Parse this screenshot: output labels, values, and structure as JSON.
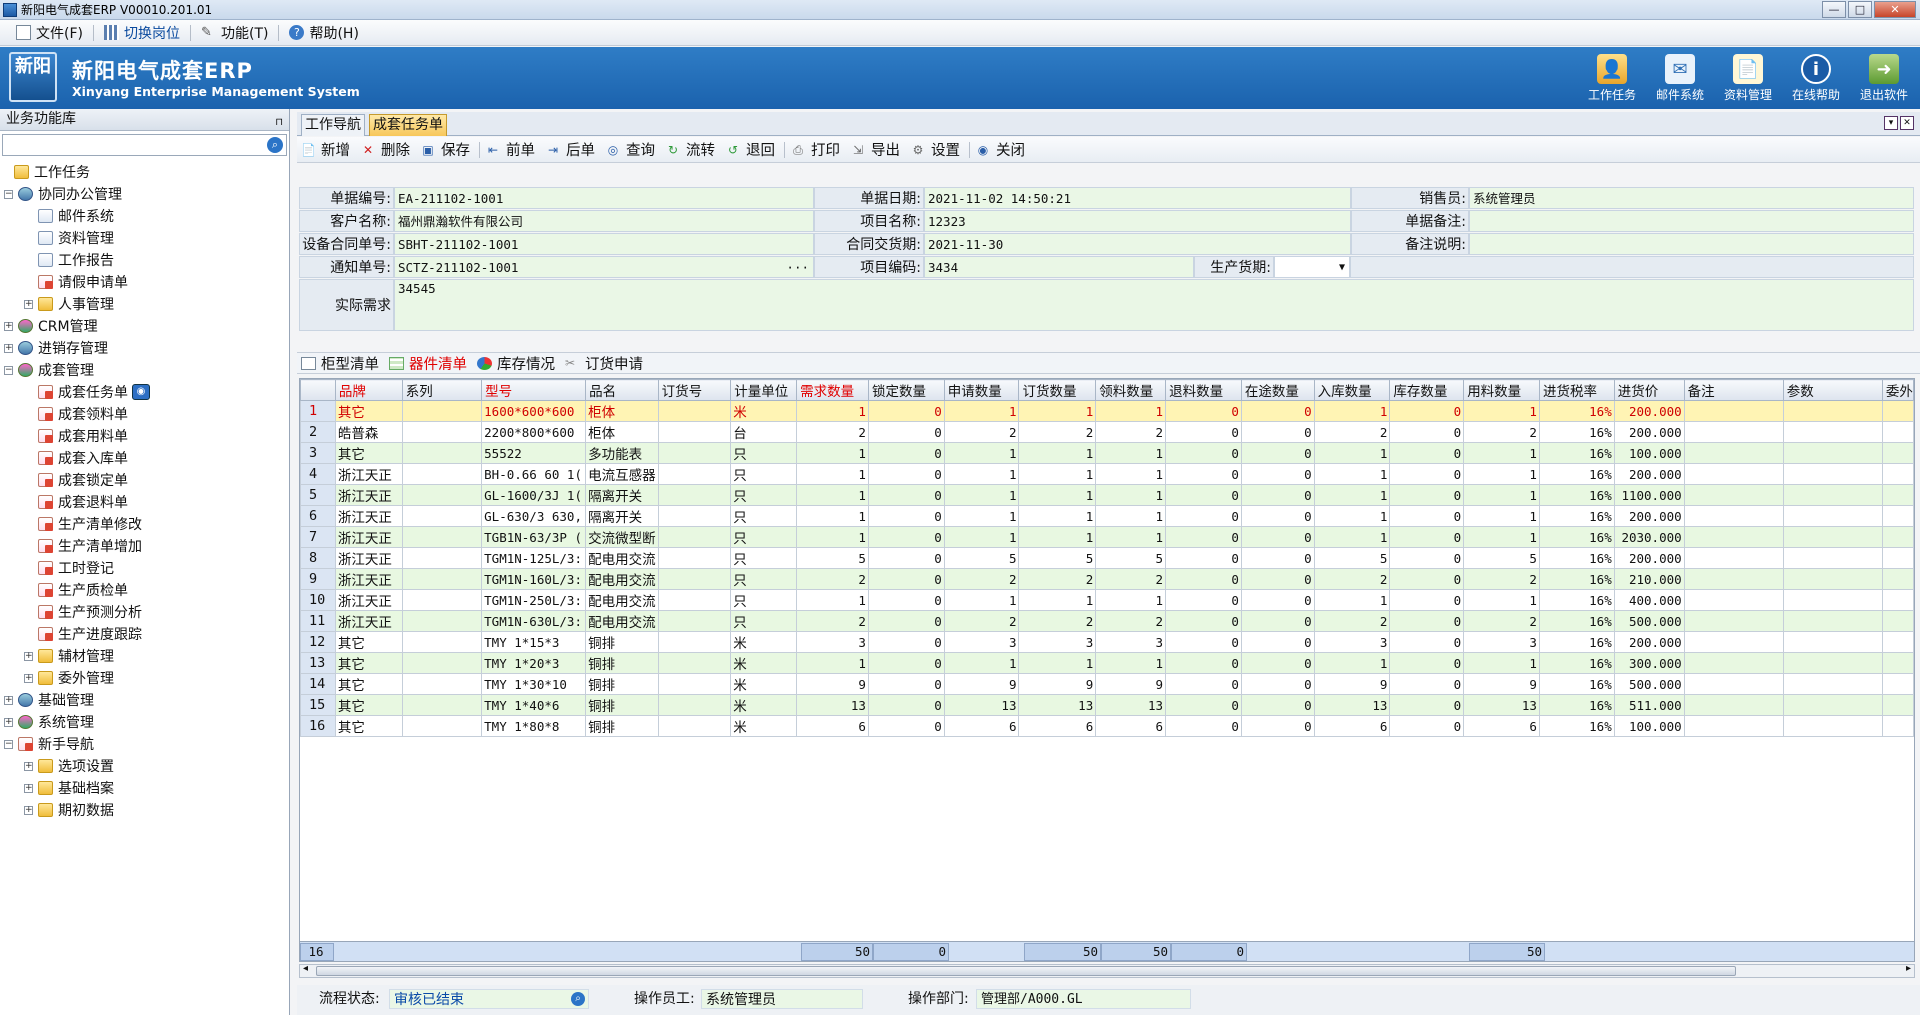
{
  "window": {
    "title": "新阳电气成套ERP V00010.201.01"
  },
  "menu": [
    {
      "label": "文件(F)"
    },
    {
      "label": "切换岗位"
    },
    {
      "label": "功能(T)"
    },
    {
      "label": "帮助(H)"
    }
  ],
  "header": {
    "logo": "新阳",
    "title": "新阳电气成套ERP",
    "subtitle": "Xinyang Enterprise Management System",
    "tools": [
      "工作任务",
      "邮件系统",
      "资料管理",
      "在线帮助",
      "退出软件"
    ]
  },
  "sidebar": {
    "title": "业务功能库",
    "items": [
      {
        "label": "工作任务"
      },
      {
        "label": "协同办公管理"
      },
      {
        "label": "邮件系统"
      },
      {
        "label": "资料管理"
      },
      {
        "label": "工作报告"
      },
      {
        "label": "请假申请单"
      },
      {
        "label": "人事管理"
      },
      {
        "label": "CRM管理"
      },
      {
        "label": "进销存管理"
      },
      {
        "label": "成套管理"
      },
      {
        "label": "成套任务单"
      },
      {
        "label": "成套领料单"
      },
      {
        "label": "成套用料单"
      },
      {
        "label": "成套入库单"
      },
      {
        "label": "成套锁定单"
      },
      {
        "label": "成套退料单"
      },
      {
        "label": "生产清单修改"
      },
      {
        "label": "生产清单增加"
      },
      {
        "label": "工时登记"
      },
      {
        "label": "生产质检单"
      },
      {
        "label": "生产预测分析"
      },
      {
        "label": "生产进度跟踪"
      },
      {
        "label": "辅材管理"
      },
      {
        "label": "委外管理"
      },
      {
        "label": "基础管理"
      },
      {
        "label": "系统管理"
      },
      {
        "label": "新手导航"
      },
      {
        "label": "选项设置"
      },
      {
        "label": "基础档案"
      },
      {
        "label": "期初数据"
      }
    ]
  },
  "tabs": [
    "工作导航",
    "成套任务单"
  ],
  "toolbar": [
    "新增",
    "删除",
    "保存",
    "前单",
    "后单",
    "查询",
    "流转",
    "退回",
    "打印",
    "导出",
    "设置",
    "关闭"
  ],
  "form": {
    "doc_no_label": "单据编号:",
    "doc_no": "EA-211102-1001",
    "doc_date_label": "单据日期:",
    "doc_date": "2021-11-02 14:50:21",
    "sales_label": "销售员:",
    "sales": "系统管理员",
    "customer_label": "客户名称:",
    "customer": "福州鼎瀚软件有限公司",
    "project_label": "项目名称:",
    "project": "12323",
    "remark_label": "单据备注:",
    "remark": "",
    "contract_label": "设备合同单号:",
    "contract": "SBHT-211102-1001",
    "delivery_label": "合同交货期:",
    "delivery": "2021-11-30",
    "note_label": "备注说明:",
    "note": "",
    "notice_label": "通知单号:",
    "notice": "SCTZ-211102-1001",
    "notice_btn": "···",
    "code_label": "项目编码:",
    "code": "3434",
    "prod_label": "生产货期:",
    "prod": "",
    "demand_label": "实际需求",
    "demand": "34545"
  },
  "subtabs": [
    "柜型清单",
    "器件清单",
    "库存情况",
    "订货申请"
  ],
  "grid": {
    "columns": [
      "",
      "品牌",
      "系列",
      "型号",
      "品名",
      "订货号",
      "计量单位",
      "需求数量",
      "锁定数量",
      "申请数量",
      "订货数量",
      "领料数量",
      "退料数量",
      "在途数量",
      "入库数量",
      "库存数量",
      "用料数量",
      "进货税率",
      "进货价",
      "备注",
      "参数",
      "委外"
    ],
    "rows": [
      [
        "1",
        "其它",
        "",
        "1600*600*600",
        "柜体",
        "",
        "米",
        "1",
        "0",
        "1",
        "1",
        "1",
        "0",
        "0",
        "1",
        "0",
        "1",
        "16%",
        "200.000",
        "",
        "",
        ""
      ],
      [
        "2",
        "皓普森",
        "",
        "2200*800*600",
        "柜体",
        "",
        "台",
        "2",
        "0",
        "2",
        "2",
        "2",
        "0",
        "0",
        "2",
        "0",
        "2",
        "16%",
        "200.000",
        "",
        "",
        ""
      ],
      [
        "3",
        "其它",
        "",
        "55522",
        "多功能表",
        "",
        "只",
        "1",
        "0",
        "1",
        "1",
        "1",
        "0",
        "0",
        "1",
        "0",
        "1",
        "16%",
        "100.000",
        "",
        "",
        ""
      ],
      [
        "4",
        "浙江天正",
        "",
        "BH-0.66 60 1(",
        "电流互感器",
        "",
        "只",
        "1",
        "0",
        "1",
        "1",
        "1",
        "0",
        "0",
        "1",
        "0",
        "1",
        "16%",
        "200.000",
        "",
        "",
        ""
      ],
      [
        "5",
        "浙江天正",
        "",
        "GL-1600/3J 1(",
        "隔离开关",
        "",
        "只",
        "1",
        "0",
        "1",
        "1",
        "1",
        "0",
        "0",
        "1",
        "0",
        "1",
        "16%",
        "1100.000",
        "",
        "",
        ""
      ],
      [
        "6",
        "浙江天正",
        "",
        "GL-630/3 630,",
        "隔离开关",
        "",
        "只",
        "1",
        "0",
        "1",
        "1",
        "1",
        "0",
        "0",
        "1",
        "0",
        "1",
        "16%",
        "200.000",
        "",
        "",
        ""
      ],
      [
        "7",
        "浙江天正",
        "",
        "TGB1N-63/3P (",
        "交流微型断",
        "",
        "只",
        "1",
        "0",
        "1",
        "1",
        "1",
        "0",
        "0",
        "1",
        "0",
        "1",
        "16%",
        "2030.000",
        "",
        "",
        ""
      ],
      [
        "8",
        "浙江天正",
        "",
        "TGM1N-125L/3:",
        "配电用交流",
        "",
        "只",
        "5",
        "0",
        "5",
        "5",
        "5",
        "0",
        "0",
        "5",
        "0",
        "5",
        "16%",
        "200.000",
        "",
        "",
        ""
      ],
      [
        "9",
        "浙江天正",
        "",
        "TGM1N-160L/3:",
        "配电用交流",
        "",
        "只",
        "2",
        "0",
        "2",
        "2",
        "2",
        "0",
        "0",
        "2",
        "0",
        "2",
        "16%",
        "210.000",
        "",
        "",
        ""
      ],
      [
        "10",
        "浙江天正",
        "",
        "TGM1N-250L/3:",
        "配电用交流",
        "",
        "只",
        "1",
        "0",
        "1",
        "1",
        "1",
        "0",
        "0",
        "1",
        "0",
        "1",
        "16%",
        "400.000",
        "",
        "",
        ""
      ],
      [
        "11",
        "浙江天正",
        "",
        "TGM1N-630L/3:",
        "配电用交流",
        "",
        "只",
        "2",
        "0",
        "2",
        "2",
        "2",
        "0",
        "0",
        "2",
        "0",
        "2",
        "16%",
        "500.000",
        "",
        "",
        ""
      ],
      [
        "12",
        "其它",
        "",
        "TMY 1*15*3",
        "铜排",
        "",
        "米",
        "3",
        "0",
        "3",
        "3",
        "3",
        "0",
        "0",
        "3",
        "0",
        "3",
        "16%",
        "200.000",
        "",
        "",
        ""
      ],
      [
        "13",
        "其它",
        "",
        "TMY 1*20*3",
        "铜排",
        "",
        "米",
        "1",
        "0",
        "1",
        "1",
        "1",
        "0",
        "0",
        "1",
        "0",
        "1",
        "16%",
        "300.000",
        "",
        "",
        ""
      ],
      [
        "14",
        "其它",
        "",
        "TMY 1*30*10",
        "铜排",
        "",
        "米",
        "9",
        "0",
        "9",
        "9",
        "9",
        "0",
        "0",
        "9",
        "0",
        "9",
        "16%",
        "500.000",
        "",
        "",
        ""
      ],
      [
        "15",
        "其它",
        "",
        "TMY 1*40*6",
        "铜排",
        "",
        "米",
        "13",
        "0",
        "13",
        "13",
        "13",
        "0",
        "0",
        "13",
        "0",
        "13",
        "16%",
        "511.000",
        "",
        "",
        ""
      ],
      [
        "16",
        "其它",
        "",
        "TMY 1*80*8",
        "铜排",
        "",
        "米",
        "6",
        "0",
        "6",
        "6",
        "6",
        "0",
        "0",
        "6",
        "0",
        "6",
        "16%",
        "100.000",
        "",
        "",
        ""
      ]
    ],
    "totals": {
      "count": "16",
      "demand": "50",
      "locked": "0",
      "ordered": "50",
      "picked": "50",
      "returned": "0",
      "used": "50"
    }
  },
  "status": {
    "flow_label": "流程状态:",
    "flow": "审核已结束",
    "operator_label": "操作员工:",
    "operator": "系统管理员",
    "dept_label": "操作部门:",
    "dept": "管理部/A000.GL"
  },
  "colors": {
    "header_blue": "#1f68b3",
    "selected_row": "#fff4b4",
    "alt_row": "#e8f8e1",
    "form_value": "#eaf7e6"
  }
}
